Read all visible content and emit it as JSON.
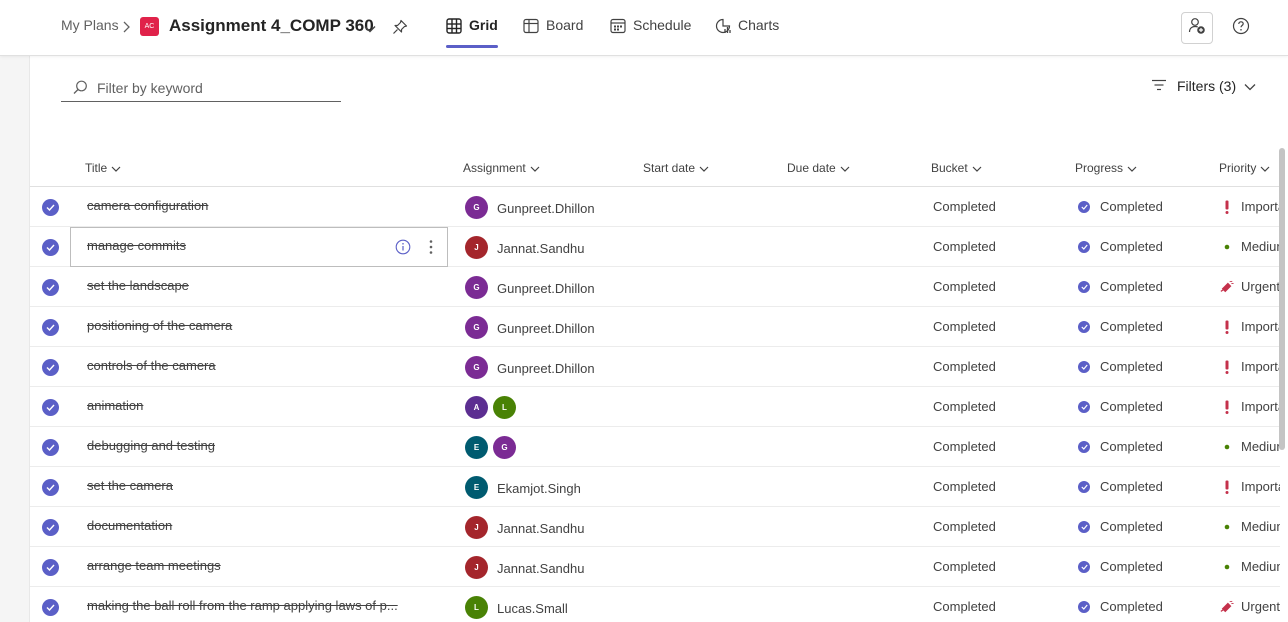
{
  "breadcrumb": {
    "root": "My Plans"
  },
  "plan": {
    "badge": "AC",
    "title": "Assignment 4_COMP 360",
    "badge_color": "#e0224a"
  },
  "tabs": [
    {
      "label": "Grid",
      "icon": "grid-icon",
      "active": true
    },
    {
      "label": "Board",
      "icon": "board-icon",
      "active": false
    },
    {
      "label": "Schedule",
      "icon": "calendar-icon",
      "active": false
    },
    {
      "label": "Charts",
      "icon": "chart-icon",
      "active": false
    }
  ],
  "search": {
    "placeholder": "Filter by keyword",
    "value": ""
  },
  "filters": {
    "label": "Filters (3)"
  },
  "columns": {
    "title": "Title",
    "assignment": "Assignment",
    "start": "Start date",
    "due": "Due date",
    "bucket": "Bucket",
    "progress": "Progress",
    "priority": "Priority"
  },
  "accent": "#5b5fc7",
  "tasks": [
    {
      "title": "camera configuration",
      "assignees": [
        {
          "initial": "G",
          "color": "#7b2b94"
        }
      ],
      "assignee_name": "Gunpreet.Dhillon",
      "bucket": "Completed",
      "progress": "Completed",
      "priority": "Important",
      "priority_icon": "important-icon"
    },
    {
      "title": "manage commits",
      "assignees": [
        {
          "initial": "J",
          "color": "#a4262c"
        }
      ],
      "assignee_name": "Jannat.Sandhu",
      "bucket": "Completed",
      "progress": "Completed",
      "priority": "Medium",
      "priority_icon": "medium-dot-icon",
      "focused": true
    },
    {
      "title": "set the landscape",
      "assignees": [
        {
          "initial": "G",
          "color": "#7b2b94"
        }
      ],
      "assignee_name": "Gunpreet.Dhillon",
      "bucket": "Completed",
      "progress": "Completed",
      "priority": "Urgent",
      "priority_icon": "urgent-icon"
    },
    {
      "title": "positioning of the camera",
      "assignees": [
        {
          "initial": "G",
          "color": "#7b2b94"
        }
      ],
      "assignee_name": "Gunpreet.Dhillon",
      "bucket": "Completed",
      "progress": "Completed",
      "priority": "Important",
      "priority_icon": "important-icon"
    },
    {
      "title": "controls of the camera",
      "assignees": [
        {
          "initial": "G",
          "color": "#7b2b94"
        }
      ],
      "assignee_name": "Gunpreet.Dhillon",
      "bucket": "Completed",
      "progress": "Completed",
      "priority": "Important",
      "priority_icon": "important-icon"
    },
    {
      "title": "animation",
      "assignees": [
        {
          "initial": "A",
          "color": "#5c2e91"
        },
        {
          "initial": "L",
          "color": "#498205"
        }
      ],
      "assignee_name": "",
      "bucket": "Completed",
      "progress": "Completed",
      "priority": "Important",
      "priority_icon": "important-icon"
    },
    {
      "title": "debugging and testing",
      "assignees": [
        {
          "initial": "E",
          "color": "#005b70"
        },
        {
          "initial": "G",
          "color": "#7b2b94"
        }
      ],
      "assignee_name": "",
      "bucket": "Completed",
      "progress": "Completed",
      "priority": "Medium",
      "priority_icon": "medium-dot-icon"
    },
    {
      "title": "set the camera",
      "assignees": [
        {
          "initial": "E",
          "color": "#005b70"
        }
      ],
      "assignee_name": "Ekamjot.Singh",
      "bucket": "Completed",
      "progress": "Completed",
      "priority": "Important",
      "priority_icon": "important-icon"
    },
    {
      "title": "documentation",
      "assignees": [
        {
          "initial": "J",
          "color": "#a4262c"
        }
      ],
      "assignee_name": "Jannat.Sandhu",
      "bucket": "Completed",
      "progress": "Completed",
      "priority": "Medium",
      "priority_icon": "medium-dot-icon"
    },
    {
      "title": "arrange team meetings",
      "assignees": [
        {
          "initial": "J",
          "color": "#a4262c"
        }
      ],
      "assignee_name": "Jannat.Sandhu",
      "bucket": "Completed",
      "progress": "Completed",
      "priority": "Medium",
      "priority_icon": "medium-dot-icon"
    },
    {
      "title": "making the ball roll from the ramp applying laws of p...",
      "assignees": [
        {
          "initial": "L",
          "color": "#498205"
        }
      ],
      "assignee_name": "Lucas.Small",
      "bucket": "Completed",
      "progress": "Completed",
      "priority": "Urgent",
      "priority_icon": "urgent-icon"
    }
  ]
}
